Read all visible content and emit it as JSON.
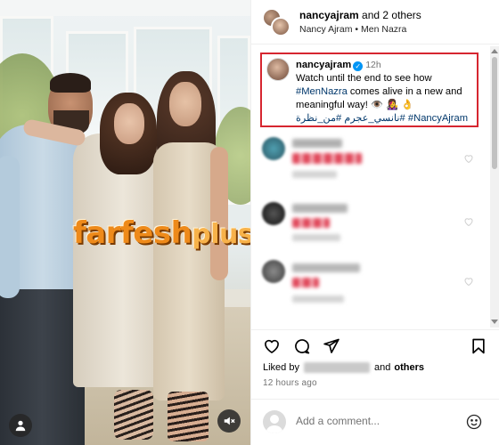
{
  "photo": {
    "watermark_main": "farfesh",
    "watermark_tail": "plus.com"
  },
  "post": {
    "author": "nancyajram",
    "coauthors_text": "and 2 others",
    "subtitle": "Nancy Ajram • Men Nazra",
    "caption": {
      "username": "nancyajram",
      "age": "12h",
      "text_line1": "Watch until the end to see how",
      "hashtag_men_nazra": "#MenNazra",
      "text_line2": " comes alive in a new and",
      "text_line3": "meaningful way! 👁️ 👩‍🎤 👌",
      "hashtag_ar1": "#من_نظرة",
      "hashtag_ar2": "#نانسي_عجرم",
      "hashtag_nancy": "#NancyAjram"
    }
  },
  "likes": {
    "prefix": "Liked by",
    "suffix": "others",
    "conjunction": "and"
  },
  "timestamp": "12 hours ago",
  "comment_input": {
    "placeholder": "Add a comment..."
  },
  "icons": {
    "verified": "verified-badge-icon",
    "like": "heart-icon",
    "comment": "comment-bubble-icon",
    "share": "paper-plane-icon",
    "save": "bookmark-icon",
    "user_tag": "person-icon",
    "mute": "speaker-muted-icon",
    "emoji": "smiley-icon"
  },
  "colors": {
    "caption_highlight": "#d62630",
    "hashtag": "#00376b",
    "verified": "#0095f6",
    "watermark": "#ee8a1a"
  }
}
